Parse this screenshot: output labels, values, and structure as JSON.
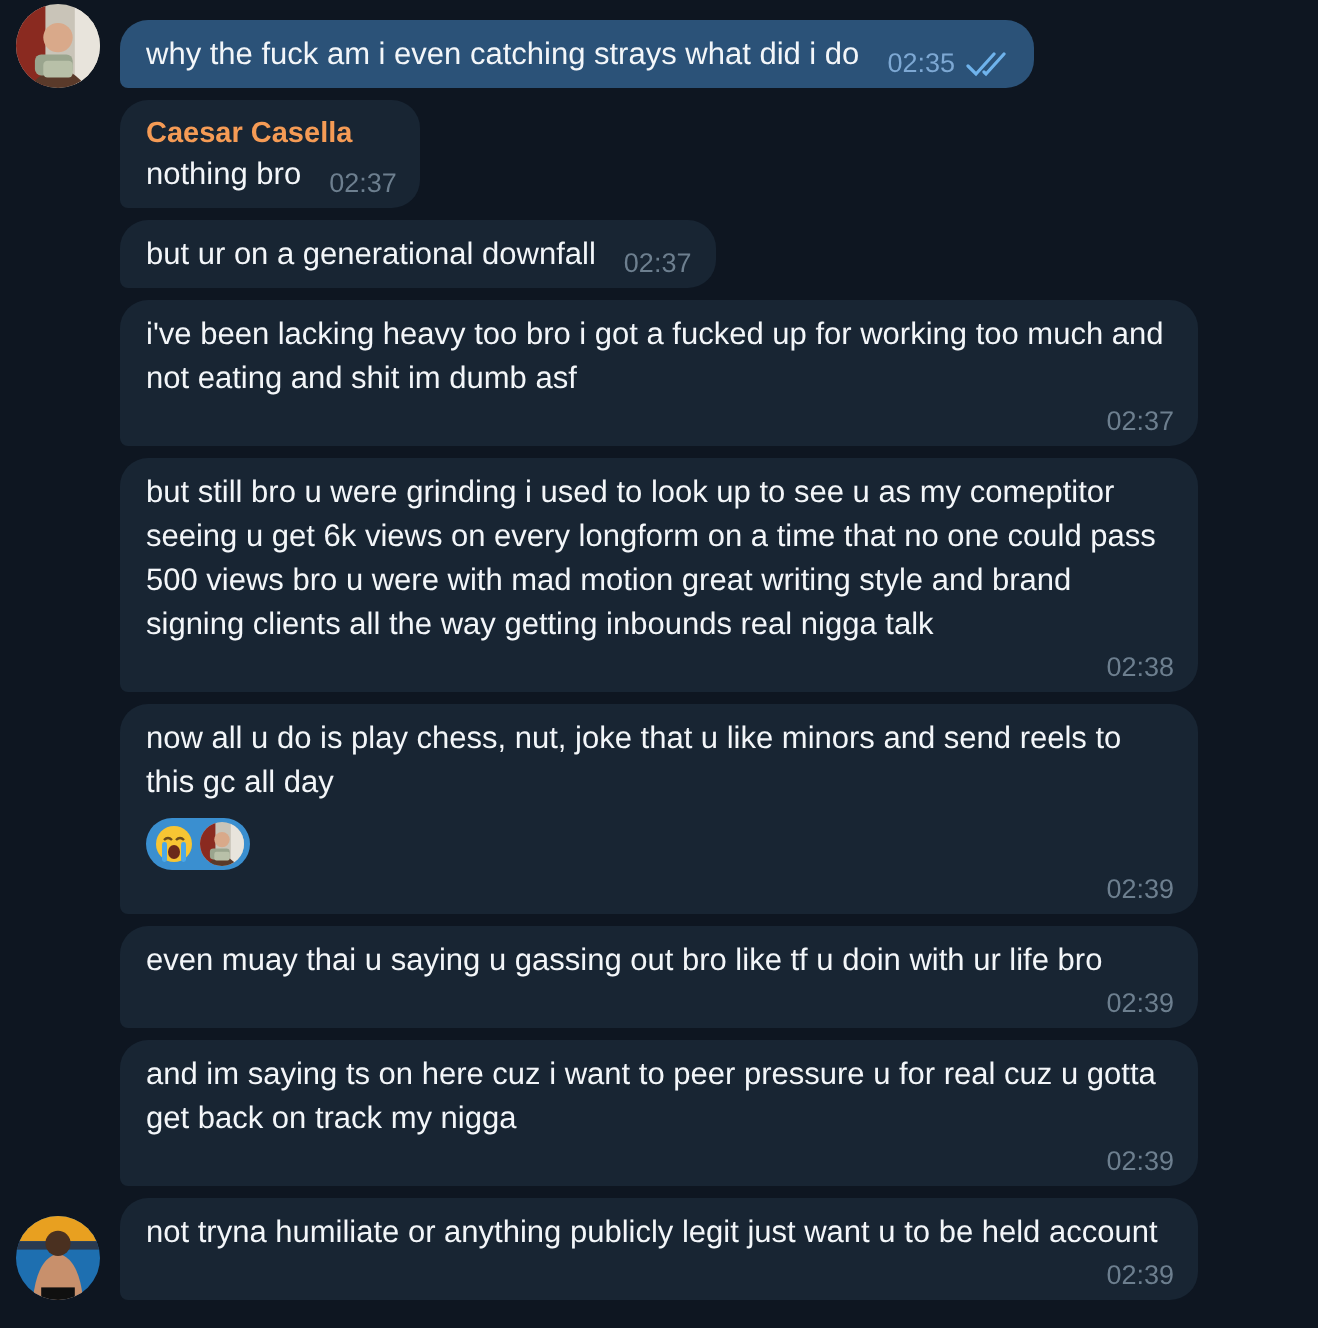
{
  "messages": [
    {
      "outgoing": true,
      "avatar": true,
      "text": "why the fuck am i even catching strays what did i do",
      "time": "02:35",
      "read": true
    },
    {
      "outgoing": false,
      "avatar": false,
      "sender": "Caesar Casella",
      "text": "nothing bro",
      "time": "02:37"
    },
    {
      "outgoing": false,
      "avatar": false,
      "text": "but ur on a generational downfall",
      "time": "02:37"
    },
    {
      "outgoing": false,
      "avatar": false,
      "text": "i've been lacking heavy too bro i got a fucked up for working too much and not eating and shit im dumb asf",
      "time": "02:37"
    },
    {
      "outgoing": false,
      "avatar": false,
      "text": "but still bro u were grinding i used to look up to see u as my comeptitor seeing u get 6k views on every longform on a time that no one could pass 500 views bro u were with mad motion great writing style and brand signing clients all the way getting inbounds real nigga talk",
      "time": "02:38"
    },
    {
      "outgoing": false,
      "avatar": false,
      "text": "now all u do is play chess, nut, joke that u like minors and send reels to this gc all day",
      "time": "02:39",
      "reactions": [
        {
          "kind": "emoji-avatar"
        }
      ]
    },
    {
      "outgoing": false,
      "avatar": false,
      "text": "even muay thai u saying u gassing out bro like tf u doin with ur life bro",
      "time": "02:39"
    },
    {
      "outgoing": false,
      "avatar": false,
      "text": "and im saying ts on here cuz i want to peer pressure u for real cuz u gotta get back on track my nigga",
      "time": "02:39"
    },
    {
      "outgoing": false,
      "avatar": true,
      "text": "not tryna humiliate or anything publicly legit just want u to be held account",
      "time": "02:39"
    }
  ]
}
